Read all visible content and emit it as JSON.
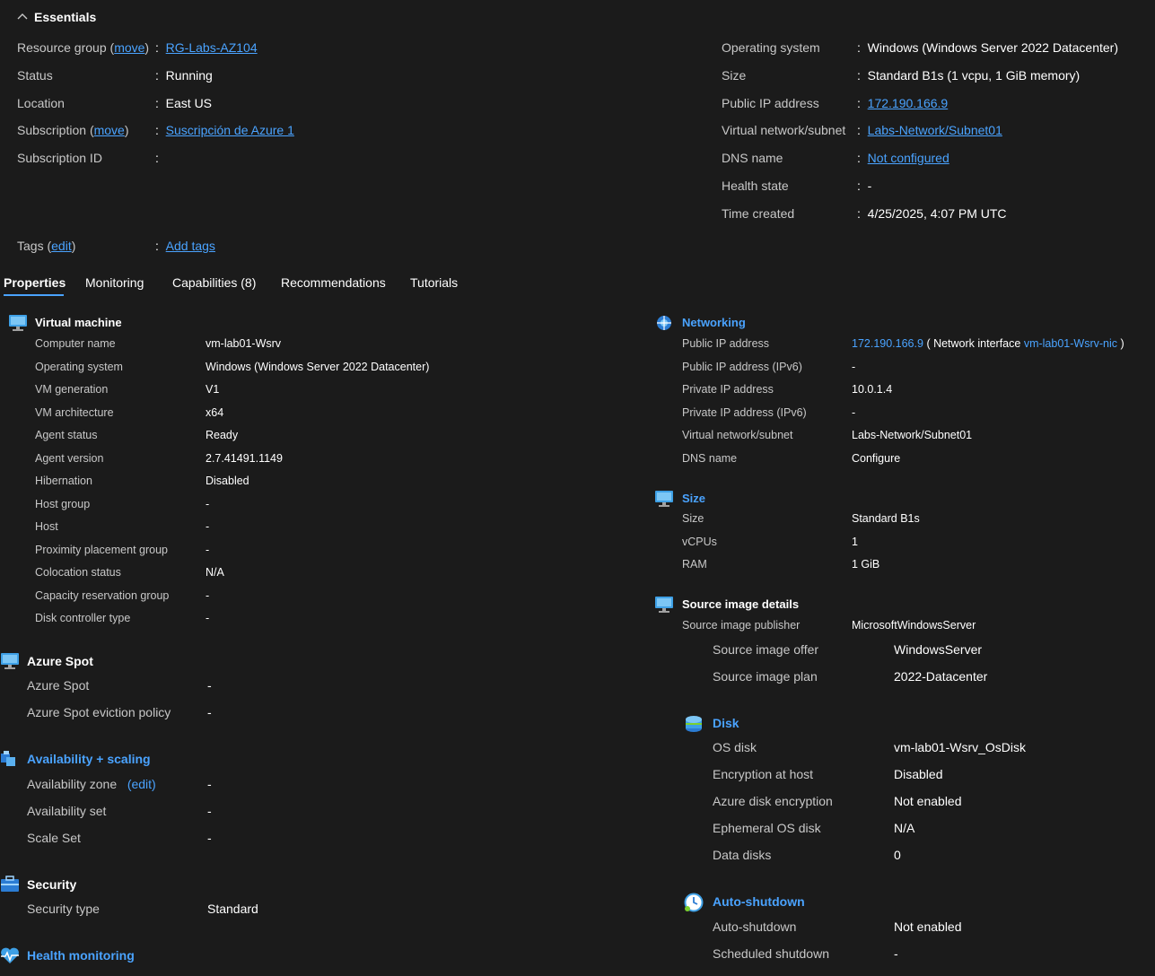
{
  "essentials": {
    "title": "Essentials",
    "left": {
      "resource_group": {
        "label": "Resource group",
        "open": "(",
        "move": "move",
        "close": ")",
        "value": "RG-Labs-AZ104"
      },
      "status": {
        "label": "Status",
        "value": "Running"
      },
      "location": {
        "label": "Location",
        "value": "East US"
      },
      "subscription": {
        "label": "Subscription",
        "open": "(",
        "move": "move",
        "close": ")",
        "value": "Suscripción de Azure 1"
      },
      "subscription_id": {
        "label": "Subscription ID",
        "value": ""
      },
      "tags": {
        "label": "Tags",
        "open": "(",
        "edit": "edit",
        "close": ")",
        "value": "Add tags"
      }
    },
    "right": {
      "os": {
        "label": "Operating system",
        "value": "Windows (Windows Server 2022 Datacenter)"
      },
      "size": {
        "label": "Size",
        "value": "Standard B1s (1 vcpu, 1 GiB memory)"
      },
      "public_ip": {
        "label": "Public IP address",
        "value": "172.190.166.9"
      },
      "vnet": {
        "label": "Virtual network/subnet",
        "value": "Labs-Network/Subnet01"
      },
      "dns": {
        "label": "DNS name",
        "value": "Not configured"
      },
      "health": {
        "label": "Health state",
        "value": "-"
      },
      "time_created": {
        "label": "Time created",
        "value": "4/25/2025, 4:07 PM UTC"
      }
    },
    "colon": ":"
  },
  "tabs": [
    "Properties",
    "Monitoring",
    "Capabilities (8)",
    "Recommendations",
    "Tutorials"
  ],
  "virtual_machine": {
    "title": "Virtual machine",
    "rows": [
      {
        "label": "Computer name",
        "value": "vm-lab01-Wsrv"
      },
      {
        "label": "Operating system",
        "value": "Windows (Windows Server 2022 Datacenter)"
      },
      {
        "label": "VM generation",
        "value": "V1"
      },
      {
        "label": "VM architecture",
        "value": "x64"
      },
      {
        "label": "Agent status",
        "value": "Ready"
      },
      {
        "label": "Agent version",
        "value": "2.7.41491.1149"
      },
      {
        "label": "Hibernation",
        "value": "Disabled"
      },
      {
        "label": "Host group",
        "value": "-"
      },
      {
        "label": "Host",
        "value": "-"
      },
      {
        "label": "Proximity placement group",
        "value": "-"
      },
      {
        "label": "Colocation status",
        "value": "N/A"
      },
      {
        "label": "Capacity reservation group",
        "value": "-"
      },
      {
        "label": "Disk controller type",
        "value": "-"
      }
    ]
  },
  "azure_spot": {
    "title": "Azure Spot",
    "rows": [
      {
        "label": "Azure Spot",
        "value": "-"
      },
      {
        "label": "Azure Spot eviction policy",
        "value": "-"
      }
    ]
  },
  "availability": {
    "title": "Availability + scaling",
    "rows": [
      {
        "label": "Availability zone",
        "edit": "(edit)",
        "value": "-"
      },
      {
        "label": "Availability set",
        "value": "-"
      },
      {
        "label": "Scale Set",
        "value": "-"
      }
    ]
  },
  "security": {
    "title": "Security",
    "rows": [
      {
        "label": "Security type",
        "value": "Standard"
      }
    ]
  },
  "health_monitoring": {
    "title": "Health monitoring"
  },
  "networking": {
    "title": "Networking",
    "public_ip": {
      "label": "Public IP address",
      "ip": "172.190.166.9",
      "nic_open": "( Network interface",
      "nic": "vm-lab01-Wsrv-nic",
      "nic_close": ")"
    },
    "rows": [
      {
        "label": "Public IP address (IPv6)",
        "value": "-"
      },
      {
        "label": "Private IP address",
        "value": "10.0.1.4"
      },
      {
        "label": "Private IP address (IPv6)",
        "value": "-"
      },
      {
        "label": "Virtual network/subnet",
        "value": "Labs-Network/Subnet01"
      },
      {
        "label": "DNS name",
        "value": "Configure"
      }
    ]
  },
  "size": {
    "title": "Size",
    "rows": [
      {
        "label": "Size",
        "value": "Standard B1s"
      },
      {
        "label": "vCPUs",
        "value": "1"
      },
      {
        "label": "RAM",
        "value": "1 GiB"
      }
    ]
  },
  "source_image": {
    "title": "Source image details",
    "rows": [
      {
        "label": "Source image publisher",
        "value": "MicrosoftWindowsServer"
      },
      {
        "label": "Source image offer",
        "value": "WindowsServer"
      },
      {
        "label": "Source image plan",
        "value": "2022-Datacenter"
      }
    ]
  },
  "disk": {
    "title": "Disk",
    "rows": [
      {
        "label": "OS disk",
        "value": "vm-lab01-Wsrv_OsDisk"
      },
      {
        "label": "Encryption at host",
        "value": "Disabled"
      },
      {
        "label": "Azure disk encryption",
        "value": "Not enabled"
      },
      {
        "label": "Ephemeral OS disk",
        "value": "N/A"
      },
      {
        "label": "Data disks",
        "value": "0"
      }
    ]
  },
  "auto_shutdown": {
    "title": "Auto-shutdown",
    "rows": [
      {
        "label": "Auto-shutdown",
        "value": "Not enabled"
      },
      {
        "label": "Scheduled shutdown",
        "value": "-"
      }
    ]
  },
  "colors": {
    "accent": "#4aa3ff",
    "background": "#1b1b1b"
  }
}
